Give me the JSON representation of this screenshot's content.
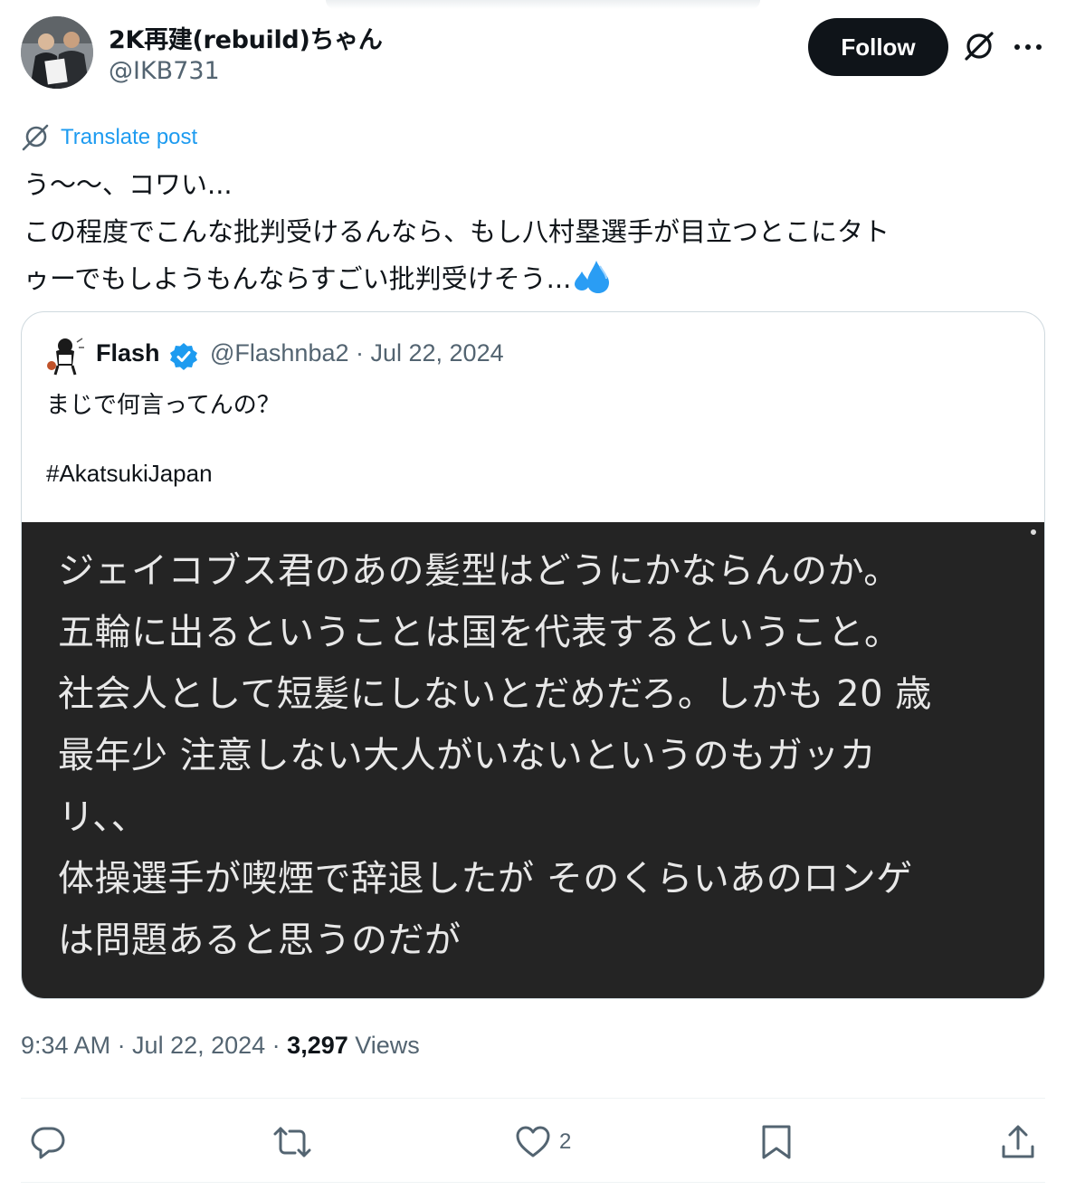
{
  "author": {
    "display_name": "2K再建(rebuild)ちゃん",
    "handle": "@IKB731",
    "follow_label": "Follow"
  },
  "post": {
    "translate_label": "Translate post",
    "text_lines": [
      "う〜〜、コワい...",
      "この程度でこんな批判受けるんなら、もし八村塁選手が目立つとこにタト",
      "ゥーでもしようもんならすごい批判受けそう..."
    ],
    "emoji": "sweat-droplets-icon"
  },
  "quote": {
    "name": "Flash",
    "meta": "@Flashnba2 · Jul 22, 2024",
    "text": "まじで何言ってんの？",
    "hashtag": "#AkatsukiJapan",
    "image_text_lines": [
      "ジェイコブス君のあの髪型はどうにかならんのか。",
      "五輪に出るということは国を代表するということ。",
      "社会人として短髪にしないとだめだろ。しかも 20 歳",
      "最年少 注意しない大人がいないというのもガッカ",
      "リ、、",
      "体操選手が喫煙で辞退したが そのくらいあのロンゲ",
      "は問題あると思うのだが"
    ]
  },
  "meta": {
    "time": "9:34 AM · Jul 22, 2024 · ",
    "views_count": "3,297",
    "views_label": " Views"
  },
  "actions": {
    "reply_count": "",
    "repost_count": "",
    "like_count": "2"
  },
  "colors": {
    "accent": "#1d9bf0",
    "text": "#0f1419",
    "secondary": "#536471",
    "border": "#cfd9de"
  }
}
